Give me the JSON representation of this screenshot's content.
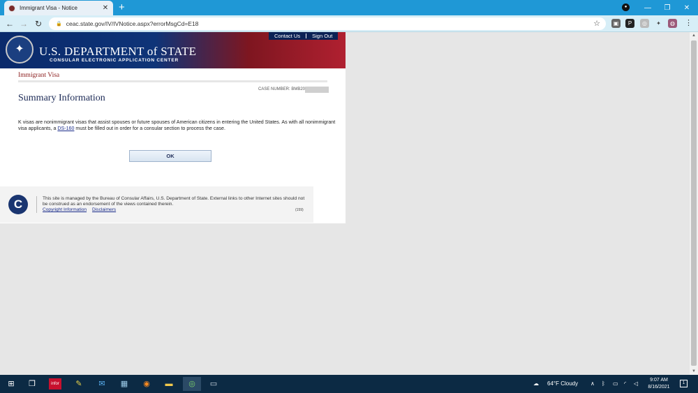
{
  "browser": {
    "tab_title": "Immigrant Visa - Notice",
    "tab_close": "✕",
    "new_tab": "+",
    "url": "ceac.state.gov/IV/IVNotice.aspx?errorMsgCd=E18",
    "window_minimize": "—",
    "window_restore": "❐",
    "window_close": "✕",
    "extensions": [
      "▣",
      "P",
      "◎",
      "✦",
      "◍"
    ],
    "menu": "⋮"
  },
  "site": {
    "top_links": [
      "Contact Us",
      "Sign Out"
    ],
    "dept_name": "U.S. DEPARTMENT of STATE",
    "subtitle": "CONSULAR ELECTRONIC APPLICATION CENTER",
    "section_title": "Immigrant Visa",
    "case_number_label": "CASE NUMBER: BMB20",
    "heading": "Summary Information",
    "message_part1": "K visas are nonimmigrant visas that assist spouses or future spouses of American citizens in entering the United States. As with all nonimmigrant visa applicants, a ",
    "message_link": "DS-160",
    "message_part2": " must be filled out in order for a consular section to process the case.",
    "ok_button": "OK",
    "footer_text": "This site is managed by the Bureau of Consular Affairs, U.S. Department of State. External links to other Internet sites should not be construed as an endorsement of the views contained therein.",
    "footer_links": [
      "Copyright Information",
      "Disclaimers"
    ],
    "footer_code": "(159)"
  },
  "taskbar": {
    "weather": "64°F  Cloudy",
    "time": "9:07 AM",
    "date": "8/16/2021",
    "notif_count": "1"
  }
}
